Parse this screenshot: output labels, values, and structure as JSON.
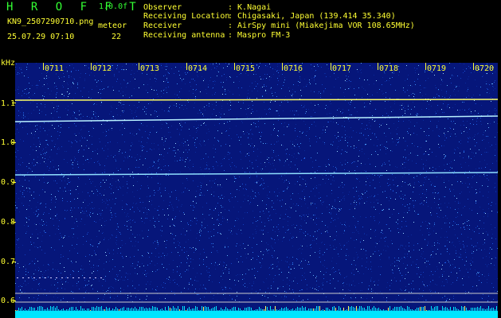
{
  "header": {
    "title": "H R O F F T",
    "version": "1.0.0f",
    "filename": "KN9_2507290710.png",
    "meteor_label": "meteor",
    "timestamp": "25.07.29 07:10",
    "meteor_count": "22",
    "fields": [
      {
        "label": "Observer",
        "value": ": K.Nagai"
      },
      {
        "label": "Receiving Location",
        "value": ": Chigasaki, Japan (139.414 35.340)"
      },
      {
        "label": "Receiver",
        "value": ": AirSpy mini (Miakejima VOR 108.65MHz)"
      },
      {
        "label": "Receiving antenna",
        "value": ": Maspro FM-3"
      }
    ]
  },
  "axis": {
    "unit": "kHz",
    "ticks": [
      "1.1",
      "1.0",
      "0.9",
      "0.8",
      "0.7",
      "0.6"
    ]
  },
  "time_labels": [
    "0711",
    "0712",
    "0713",
    "0714",
    "0715",
    "0716",
    "0717",
    "0718",
    "0719",
    "0720"
  ],
  "colors": {
    "background": "#06167a",
    "text_yellow": "#ffff33",
    "text_green": "#33ff33",
    "signal": "#ffff66",
    "noise_floor": "#00e5ff"
  }
}
